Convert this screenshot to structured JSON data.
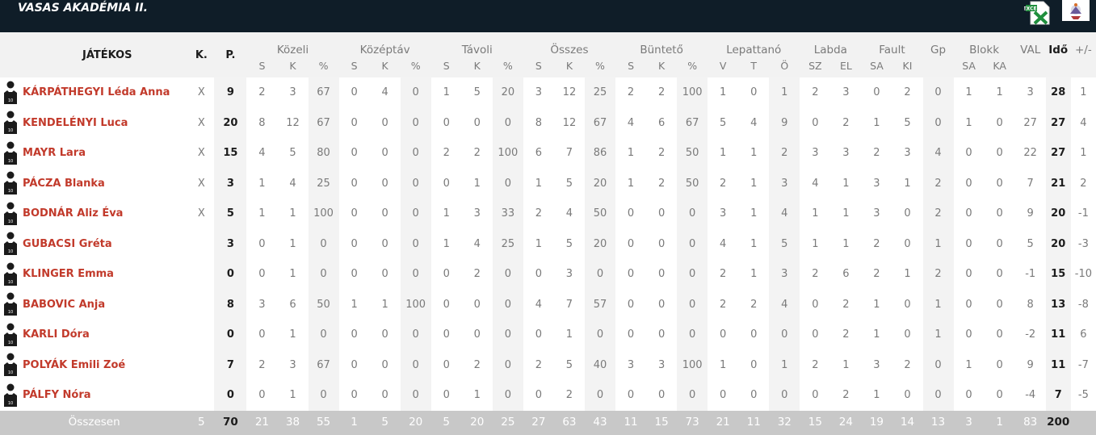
{
  "team": {
    "title": "VASAS AKADÉMIA II."
  },
  "icons": {
    "excel": "excel-export-icon",
    "logo": "team-logo-icon",
    "player": "player-jersey-icon"
  },
  "colors": {
    "topbar": "#0f1d28",
    "player_name": "#c23a2b",
    "header_bg": "#f2f2f2",
    "footer_bg": "#c8c8c8"
  },
  "header": {
    "player": "JÁTÉKOS",
    "starter": "K.",
    "points": "P.",
    "groups": [
      "Közeli",
      "Középtáv",
      "Távoli",
      "Összes",
      "Büntető",
      "Lepattanó",
      "Labda",
      "Fault",
      "Gp",
      "Blokk",
      "VAL",
      "Idő",
      "+/-"
    ],
    "sub": {
      "shots": [
        "S",
        "K",
        "%"
      ],
      "rebounds": [
        "V",
        "T",
        "Ö"
      ],
      "ball": [
        "SZ",
        "EL"
      ],
      "fouls": [
        "SA",
        "KI"
      ],
      "blocks": [
        "SA",
        "KA"
      ]
    }
  },
  "players": [
    {
      "name": "KÁRPÁTHEGYI Léda Anna",
      "starter": "X",
      "points": "9",
      "stats": [
        "2",
        "3",
        "67",
        "0",
        "4",
        "0",
        "1",
        "5",
        "20",
        "3",
        "12",
        "25",
        "2",
        "2",
        "100",
        "1",
        "0",
        "1",
        "2",
        "3",
        "0",
        "2",
        "0",
        "1",
        "1"
      ],
      "val": "3",
      "time": "28",
      "pm": "1"
    },
    {
      "name": "KENDELÉNYI Luca",
      "starter": "X",
      "points": "20",
      "stats": [
        "8",
        "12",
        "67",
        "0",
        "0",
        "0",
        "0",
        "0",
        "0",
        "8",
        "12",
        "67",
        "4",
        "6",
        "67",
        "5",
        "4",
        "9",
        "0",
        "2",
        "1",
        "5",
        "0",
        "1",
        "0"
      ],
      "val": "27",
      "time": "27",
      "pm": "4"
    },
    {
      "name": "MAYR Lara",
      "starter": "X",
      "points": "15",
      "stats": [
        "4",
        "5",
        "80",
        "0",
        "0",
        "0",
        "2",
        "2",
        "100",
        "6",
        "7",
        "86",
        "1",
        "2",
        "50",
        "1",
        "1",
        "2",
        "3",
        "3",
        "2",
        "3",
        "4",
        "0",
        "0"
      ],
      "val": "22",
      "time": "27",
      "pm": "1"
    },
    {
      "name": "PÁCZA Blanka",
      "starter": "X",
      "points": "3",
      "stats": [
        "1",
        "4",
        "25",
        "0",
        "0",
        "0",
        "0",
        "1",
        "0",
        "1",
        "5",
        "20",
        "1",
        "2",
        "50",
        "2",
        "1",
        "3",
        "4",
        "1",
        "3",
        "1",
        "2",
        "0",
        "0"
      ],
      "val": "7",
      "time": "21",
      "pm": "2"
    },
    {
      "name": "BODNÁR Aliz Éva",
      "starter": "X",
      "points": "5",
      "stats": [
        "1",
        "1",
        "100",
        "0",
        "0",
        "0",
        "1",
        "3",
        "33",
        "2",
        "4",
        "50",
        "0",
        "0",
        "0",
        "3",
        "1",
        "4",
        "1",
        "1",
        "3",
        "0",
        "2",
        "0",
        "0"
      ],
      "val": "9",
      "time": "20",
      "pm": "-1"
    },
    {
      "name": "GUBACSI Gréta",
      "starter": "",
      "points": "3",
      "stats": [
        "0",
        "1",
        "0",
        "0",
        "0",
        "0",
        "1",
        "4",
        "25",
        "1",
        "5",
        "20",
        "0",
        "0",
        "0",
        "4",
        "1",
        "5",
        "1",
        "1",
        "2",
        "0",
        "1",
        "0",
        "0"
      ],
      "val": "5",
      "time": "20",
      "pm": "-3"
    },
    {
      "name": "KLINGER Emma",
      "starter": "",
      "points": "0",
      "stats": [
        "0",
        "1",
        "0",
        "0",
        "0",
        "0",
        "0",
        "2",
        "0",
        "0",
        "3",
        "0",
        "0",
        "0",
        "0",
        "2",
        "1",
        "3",
        "2",
        "6",
        "2",
        "1",
        "2",
        "0",
        "0"
      ],
      "val": "-1",
      "time": "15",
      "pm": "-10"
    },
    {
      "name": "BABOVIC Anja",
      "starter": "",
      "points": "8",
      "stats": [
        "3",
        "6",
        "50",
        "1",
        "1",
        "100",
        "0",
        "0",
        "0",
        "4",
        "7",
        "57",
        "0",
        "0",
        "0",
        "2",
        "2",
        "4",
        "0",
        "2",
        "1",
        "0",
        "1",
        "0",
        "0"
      ],
      "val": "8",
      "time": "13",
      "pm": "-8"
    },
    {
      "name": "KARLI Dóra",
      "starter": "",
      "points": "0",
      "stats": [
        "0",
        "1",
        "0",
        "0",
        "0",
        "0",
        "0",
        "0",
        "0",
        "0",
        "1",
        "0",
        "0",
        "0",
        "0",
        "0",
        "0",
        "0",
        "0",
        "2",
        "1",
        "0",
        "1",
        "0",
        "0"
      ],
      "val": "-2",
      "time": "11",
      "pm": "6"
    },
    {
      "name": "POLYÁK Emili Zoé",
      "starter": "",
      "points": "7",
      "stats": [
        "2",
        "3",
        "67",
        "0",
        "0",
        "0",
        "0",
        "2",
        "0",
        "2",
        "5",
        "40",
        "3",
        "3",
        "100",
        "1",
        "0",
        "1",
        "2",
        "1",
        "3",
        "2",
        "0",
        "1",
        "0"
      ],
      "val": "9",
      "time": "11",
      "pm": "-7"
    },
    {
      "name": "PÁLFY Nóra",
      "starter": "",
      "points": "0",
      "stats": [
        "0",
        "1",
        "0",
        "0",
        "0",
        "0",
        "0",
        "1",
        "0",
        "0",
        "2",
        "0",
        "0",
        "0",
        "0",
        "0",
        "0",
        "0",
        "0",
        "2",
        "1",
        "0",
        "0",
        "0",
        "0"
      ],
      "val": "-4",
      "time": "7",
      "pm": "-5"
    }
  ],
  "totals": {
    "label": "Összesen",
    "starter": "5",
    "points": "70",
    "stats": [
      "21",
      "38",
      "55",
      "1",
      "5",
      "20",
      "5",
      "20",
      "25",
      "27",
      "63",
      "43",
      "11",
      "15",
      "73",
      "21",
      "11",
      "32",
      "15",
      "24",
      "19",
      "14",
      "13",
      "3",
      "1"
    ],
    "val": "83",
    "time": "200",
    "pm": ""
  }
}
